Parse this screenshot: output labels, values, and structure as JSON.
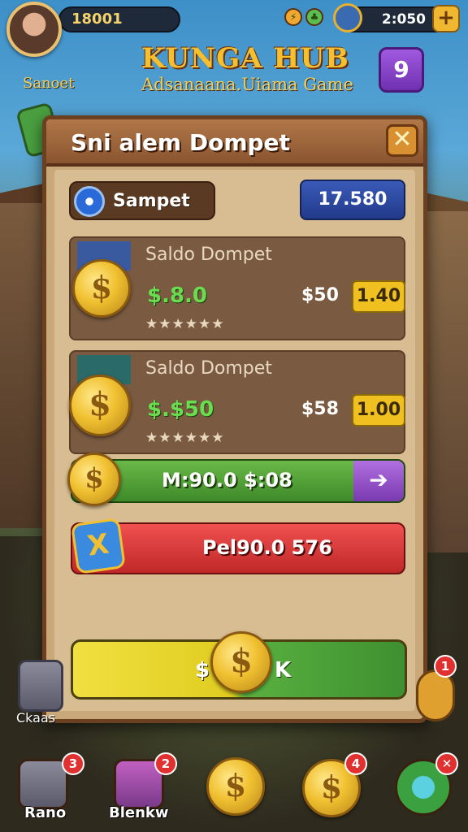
{
  "top_bar": {
    "coins": "18001",
    "gems": "2:050",
    "plus_label": "+"
  },
  "header": {
    "title": "KUNGA HUB",
    "subtitle": "Adsanaana.Uiama Game",
    "player_name": "Sanoet",
    "level": "9"
  },
  "modal": {
    "title": "Sni alem Dompet",
    "close_label": "✕",
    "wallet_label": "Sampet",
    "balance": "17.580",
    "cards": [
      {
        "title": "Saldo Dompet",
        "amount": "$.8.0",
        "stars": "★★★★★★",
        "price": "$50",
        "buy_label": "1.40"
      },
      {
        "title": "Saldo Dompet",
        "amount": "$.$50",
        "stars": "★★★★★★",
        "price": "$58",
        "buy_label": "1.00"
      }
    ],
    "green_bar_text": "M:90.0 $:08",
    "green_bar_arrow": "➔",
    "red_bar_text": "Pel90.0 576",
    "red_bar_icon": "X",
    "main_button_left": "$",
    "main_button_right": "K",
    "coin_symbol": "$"
  },
  "side": {
    "left_label": "Ckaas",
    "right_badge": "1"
  },
  "dock": {
    "items": [
      {
        "label": "Rano",
        "badge": "3"
      },
      {
        "label": "Blenkw",
        "badge": "2"
      },
      {
        "label": "",
        "badge": ""
      },
      {
        "label": "",
        "badge": "4"
      },
      {
        "label": "",
        "badge": "✕"
      }
    ]
  },
  "colors": {
    "accent_gold": "#f5c030",
    "modal_bg": "#c9a97a",
    "green": "#3e8a2a",
    "red": "#c02828",
    "purple": "#7a3ab0",
    "blue": "#223a8a"
  }
}
